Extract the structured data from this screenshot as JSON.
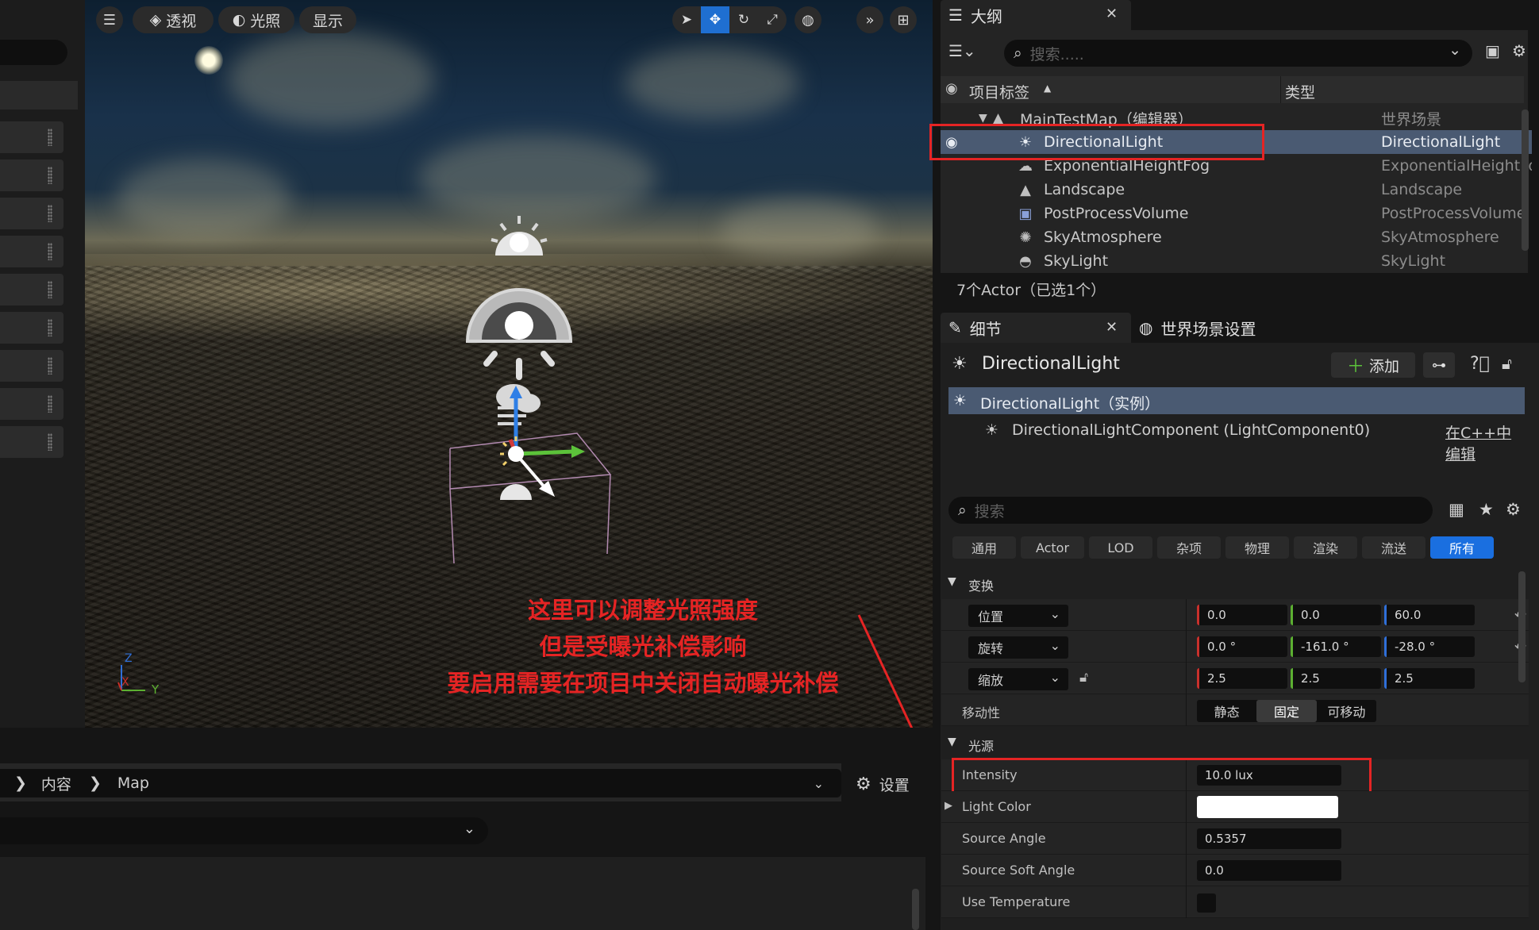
{
  "viewport_toolbar": {
    "menu_icon": "hamburger-icon",
    "perspective_label": "透视",
    "lighting_label": "光照",
    "show_label": "显示"
  },
  "annotation": {
    "line1": "这里可以调整光照强度",
    "line2": "但是受曝光补偿影响",
    "line3": "要启用需要在项目中关闭自动曝光补偿"
  },
  "axis_gizmo": {
    "z": "Z",
    "x": "X",
    "y": "Y"
  },
  "content_browser": {
    "path": [
      "内容",
      "Map"
    ],
    "settings_label": "设置"
  },
  "outliner": {
    "tab_label": "大纲",
    "search_placeholder": "搜索.....",
    "col_label": "项目标签",
    "col_type": "类型",
    "root": {
      "name": "MainTestMap（编辑器）",
      "type": "世界场景"
    },
    "items": [
      {
        "name": "DirectionalLight",
        "type": "DirectionalLight",
        "icon": "sun-icon",
        "selected": true
      },
      {
        "name": "ExponentialHeightFog",
        "type": "ExponentialHeightFog",
        "icon": "fog-icon",
        "selected": false
      },
      {
        "name": "Landscape",
        "type": "Landscape",
        "icon": "mountain-icon",
        "selected": false
      },
      {
        "name": "PostProcessVolume",
        "type": "PostProcessVolume",
        "icon": "cube-icon",
        "selected": false
      },
      {
        "name": "SkyAtmosphere",
        "type": "SkyAtmosphere",
        "icon": "sky-icon",
        "selected": false
      },
      {
        "name": "SkyLight",
        "type": "SkyLight",
        "icon": "skylight-icon",
        "selected": false
      }
    ],
    "status": "7个Actor（已选1个）"
  },
  "details": {
    "tab_label": "细节",
    "world_settings_tab": "世界场景设置",
    "actor_name": "DirectionalLight",
    "add_label": "添加",
    "instance_label": "DirectionalLight（实例）",
    "component_label": "DirectionalLightComponent (LightComponent0)",
    "edit_cpp_label": "在C++中编辑",
    "search_placeholder": "搜索",
    "filters": [
      {
        "label": "通用",
        "active": false
      },
      {
        "label": "Actor",
        "active": false
      },
      {
        "label": "LOD",
        "active": false
      },
      {
        "label": "杂项",
        "active": false
      },
      {
        "label": "物理",
        "active": false
      },
      {
        "label": "渲染",
        "active": false
      },
      {
        "label": "流送",
        "active": false
      },
      {
        "label": "所有",
        "active": true
      }
    ],
    "transform_section": "变换",
    "location_label": "位置",
    "location": [
      "0.0",
      "0.0",
      "60.0"
    ],
    "rotation_label": "旋转",
    "rotation": [
      "0.0 °",
      "-161.0 °",
      "-28.0 °"
    ],
    "scale_label": "缩放",
    "scale": [
      "2.5",
      "2.5",
      "2.5"
    ],
    "mobility_label": "移动性",
    "mobility_options": [
      "静态",
      "固定",
      "可移动"
    ],
    "mobility_selected": "固定",
    "light_section": "光源",
    "intensity_label": "Intensity",
    "intensity_value": "10.0 lux",
    "light_color_label": "Light Color",
    "light_color": "#ffffff",
    "source_angle_label": "Source Angle",
    "source_angle_value": "0.5357",
    "source_soft_angle_label": "Source Soft Angle",
    "source_soft_angle_value": "0.0",
    "use_temperature_label": "Use Temperature",
    "use_temperature": false
  },
  "colors": {
    "accent": "#1a6fe0",
    "selection": "#4a5a72",
    "annotation_red": "#e52424",
    "axis_x": "#c9302c",
    "axis_y": "#5cb031",
    "axis_z": "#2f6fd8"
  }
}
